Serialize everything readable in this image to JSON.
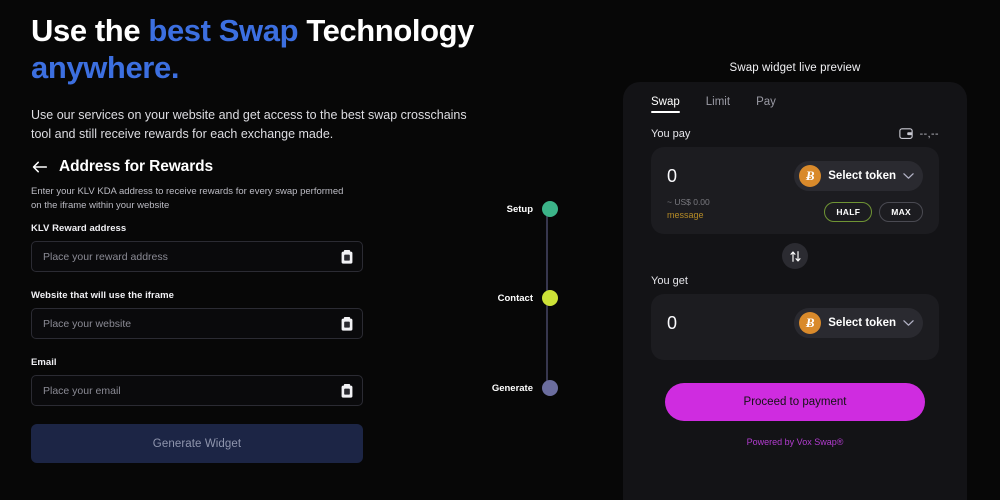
{
  "hero": {
    "title_part1": "Use the ",
    "title_accent1": "best Swap",
    "title_part2": " Technology",
    "title_accent2": "anywhere",
    "title_period": ".",
    "subtitle": "Use our services on your website and get access to the best swap crosschains tool and still receive rewards for each exchange made."
  },
  "form": {
    "back_icon": "arrow-left-icon",
    "title": "Address for Rewards",
    "description": "Enter your KLV KDA address to receive rewards for every swap performed on the iframe within your website",
    "fields": [
      {
        "label": "KLV Reward address",
        "placeholder": "Place your reward address",
        "value": "",
        "icon": "clipboard-paste-icon"
      },
      {
        "label": "Website that will use the iframe",
        "placeholder": "Place your website",
        "value": "",
        "icon": "clipboard-paste-icon"
      },
      {
        "label": "Email",
        "placeholder": "Place your email",
        "value": "",
        "icon": "clipboard-paste-icon"
      }
    ],
    "submit_label": "Generate Widget",
    "submit_bg": "#1c2545",
    "submit_color": "#8f95ad"
  },
  "stepper": {
    "line_color": "#37374e",
    "steps": [
      {
        "label": "Setup",
        "color": "#3cb489"
      },
      {
        "label": "Contact",
        "color": "#cde237"
      },
      {
        "label": "Generate",
        "color": "#6b6d9e"
      }
    ]
  },
  "preview": {
    "title": "Swap widget live preview",
    "tabs": [
      {
        "label": "Swap",
        "active": true
      },
      {
        "label": "Limit",
        "active": false
      },
      {
        "label": "Pay",
        "active": false
      }
    ],
    "pay_section": {
      "label": "You pay",
      "wallet_icon": "wallet-icon",
      "balance": "--,--",
      "amount": "0",
      "token_symbol": "Ƀ",
      "token_label": "Select token",
      "chevron_icon": "chevron-down-icon",
      "fiat_value": "~ US$ 0.00",
      "message": "message",
      "half_label": "HALF",
      "max_label": "MAX"
    },
    "switch_icon": "swap-vertical-arrows-icon",
    "get_section": {
      "label": "You get",
      "amount": "0",
      "token_symbol": "Ƀ",
      "token_label": "Select token",
      "chevron_icon": "chevron-down-icon"
    },
    "cta_label": "Proceed to payment",
    "cta_color": "#cf2ce0",
    "footer": "Powered by Vox Swap®",
    "footer_color": "#b33cd0"
  },
  "colors": {
    "page_bg": "#070707",
    "panel_bg": "#131316",
    "card_bg": "#1c1c20",
    "accent_blue": "#3c6fe0",
    "accent_magenta": "#cf2ce0",
    "token_orange": "#d98a2b",
    "half_border": "#6f9434",
    "message_gold": "#b58b26"
  }
}
